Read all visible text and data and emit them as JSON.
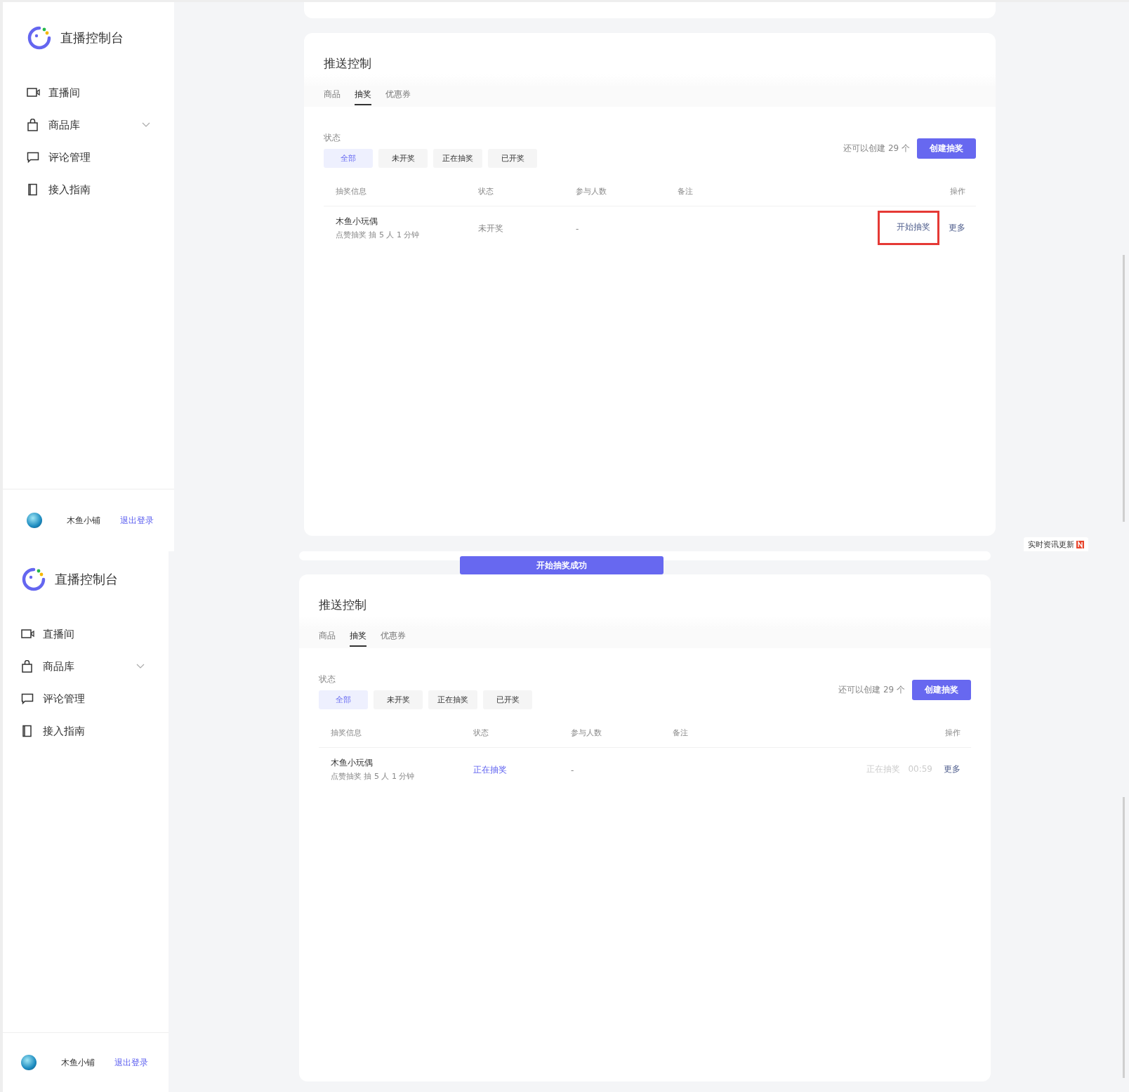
{
  "screens": [
    {
      "sidebar": {
        "title": "直播控制台",
        "items": [
          {
            "label": "直播间",
            "kind": "video"
          },
          {
            "label": "商品库",
            "kind": "bag",
            "expanded": false
          },
          {
            "label": "评论管理",
            "kind": "comment"
          },
          {
            "label": "接入指南",
            "kind": "book"
          }
        ],
        "user": {
          "name": "木鱼小铺",
          "logout": "退出登录"
        }
      },
      "panel": {
        "title": "推送控制",
        "tabs": [
          {
            "label": "商品",
            "selected": false
          },
          {
            "label": "抽奖",
            "selected": true
          },
          {
            "label": "优惠券",
            "selected": false
          }
        ],
        "filter_label": "状态",
        "filters": [
          {
            "label": "全部",
            "selected": true
          },
          {
            "label": "未开奖",
            "selected": false
          },
          {
            "label": "正在抽奖",
            "selected": false
          },
          {
            "label": "已开奖",
            "selected": false
          }
        ],
        "quota": "还可以创建 29 个",
        "create_button": "创建抽奖",
        "table": {
          "columns": [
            "抽奖信息",
            "状态",
            "参与人数",
            "备注",
            "操作"
          ],
          "rows": [
            {
              "name": "木鱼小玩偶",
              "detail": "点赞抽奖 抽 5 人  1 分钟",
              "status": {
                "label": "未开奖",
                "kind": "pending"
              },
              "participants": "-",
              "actions": [
                {
                  "label": "开始抽奖",
                  "disabled": false,
                  "highlighted": true
                },
                {
                  "label": "更多",
                  "disabled": false,
                  "highlighted": false
                }
              ]
            }
          ]
        }
      },
      "news_tag": "实时资讯更新"
    },
    {
      "sidebar": {
        "title": "直播控制台",
        "items": [
          {
            "label": "直播间",
            "kind": "video"
          },
          {
            "label": "商品库",
            "kind": "bag",
            "expanded": false
          },
          {
            "label": "评论管理",
            "kind": "comment"
          },
          {
            "label": "接入指南",
            "kind": "book"
          }
        ],
        "user": {
          "name": "木鱼小铺",
          "logout": "退出登录"
        }
      },
      "toast": "开始抽奖成功",
      "panel": {
        "title": "推送控制",
        "tabs": [
          {
            "label": "商品",
            "selected": false
          },
          {
            "label": "抽奖",
            "selected": true
          },
          {
            "label": "优惠券",
            "selected": false
          }
        ],
        "filter_label": "状态",
        "filters": [
          {
            "label": "全部",
            "selected": true
          },
          {
            "label": "未开奖",
            "selected": false
          },
          {
            "label": "正在抽奖",
            "selected": false
          },
          {
            "label": "已开奖",
            "selected": false
          }
        ],
        "quota": "还可以创建 29 个",
        "create_button": "创建抽奖",
        "table": {
          "columns": [
            "抽奖信息",
            "状态",
            "参与人数",
            "备注",
            "操作"
          ],
          "rows": [
            {
              "name": "木鱼小玩偶",
              "detail": "点赞抽奖 抽 5 人  1 分钟",
              "status": {
                "label": "正在抽奖",
                "kind": "running"
              },
              "participants": "-",
              "actions": [
                {
                  "label": "正在抽奖",
                  "timer": "00:59",
                  "disabled": true,
                  "highlighted": false
                },
                {
                  "label": "更多",
                  "disabled": false,
                  "highlighted": false
                }
              ]
            }
          ]
        }
      }
    }
  ]
}
